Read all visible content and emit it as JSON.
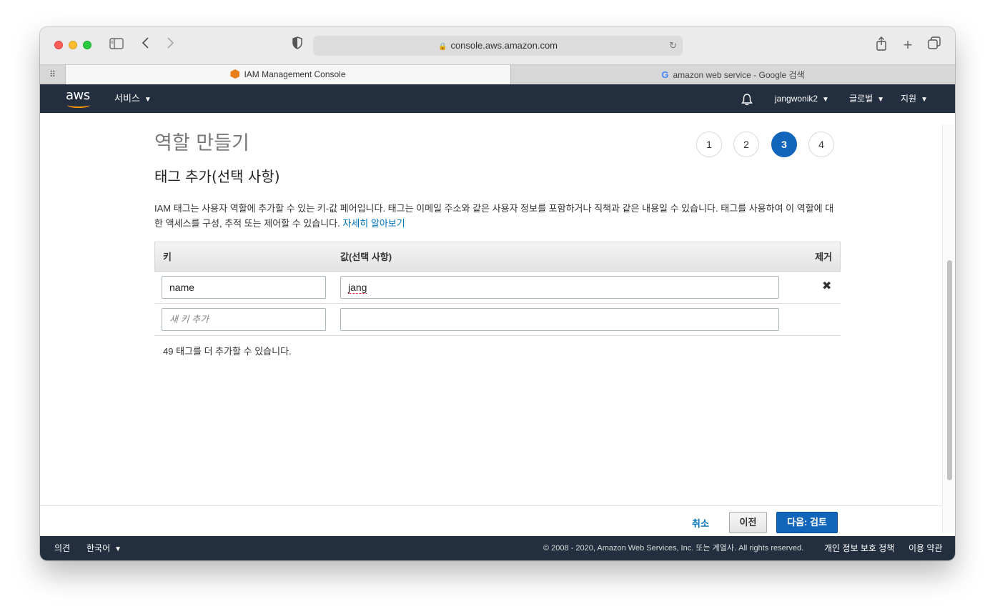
{
  "browser": {
    "url": "console.aws.amazon.com",
    "tabs": [
      {
        "title": "IAM Management Console",
        "active": true,
        "icon": "aws-cube-icon"
      },
      {
        "title": "amazon web service - Google 검색",
        "active": false,
        "icon": "google-g-icon"
      }
    ]
  },
  "awsnav": {
    "logo": "aws",
    "services": "서비스",
    "user": "jangwonik2",
    "region": "글로벌",
    "support": "지원"
  },
  "main": {
    "page_title": "역할 만들기",
    "steps": [
      "1",
      "2",
      "3",
      "4"
    ],
    "current_step": 3,
    "section_title": "태그 추가(선택 사항)",
    "description_1": "IAM 태그는 사용자 역할에 추가할 수 있는 키-값 페어입니다. 태그는 이메일 주소와 같은 사용자 정보를 포함하거나 직책과 같은 내용일 수 있습니다. 태그를 사용하여 이 역할에 대한 액세스를 구성, 추적 또는 제어할 수 있습니다.",
    "learn_more": "자세히 알아보기",
    "table": {
      "col_key": "키",
      "col_value": "값(선택 사항)",
      "col_remove": "제거",
      "rows": [
        {
          "key": "name",
          "value": "jang"
        }
      ],
      "new_key_placeholder": "새 키 추가",
      "new_value": ""
    },
    "remaining": "49 태그를 더 추가할 수 있습니다."
  },
  "actions": {
    "cancel": "취소",
    "previous": "이전",
    "next": "다음: 검토"
  },
  "footer": {
    "feedback": "의견",
    "language": "한국어",
    "copyright": "© 2008 - 2020, Amazon Web Services, Inc. 또는 계열사. All rights reserved.",
    "privacy": "개인 정보 보호 정책",
    "terms": "이용 약관"
  },
  "colors": {
    "aws_nav": "#232f3e",
    "primary_button": "#1166bb",
    "link": "#0073bb",
    "aws_orange": "#ff9900"
  }
}
